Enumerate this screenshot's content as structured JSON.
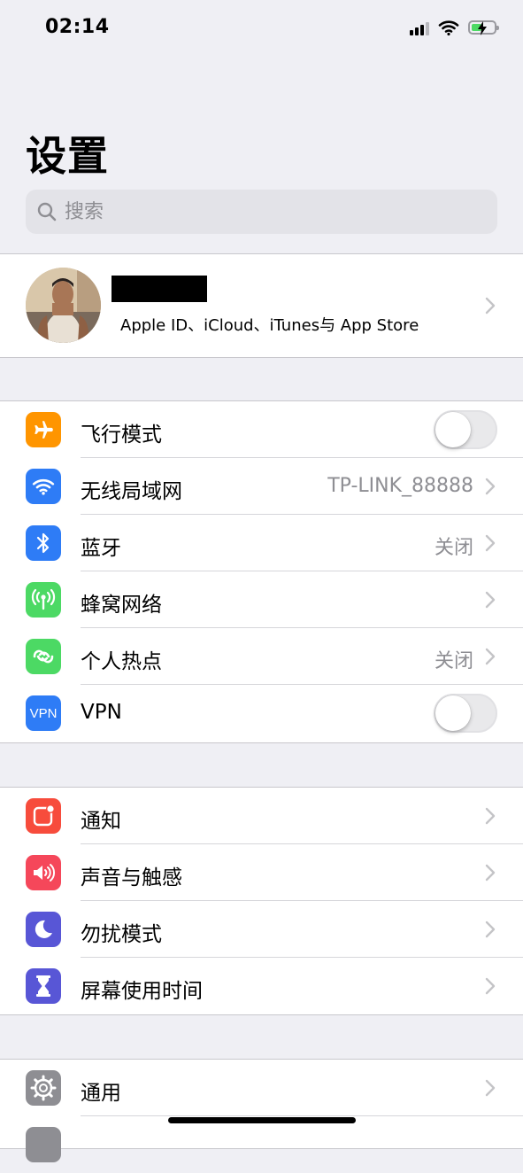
{
  "status_bar": {
    "time": "02:14"
  },
  "header": {
    "title": "设置"
  },
  "search": {
    "placeholder": "搜索"
  },
  "profile": {
    "subtitle": "Apple ID、iCloud、iTunes与 App Store"
  },
  "connectivity": [
    {
      "label": "飞行模式",
      "icon": "airplane-icon",
      "color": "#ff9500",
      "toggle": false
    },
    {
      "label": "无线局域网",
      "icon": "wifi-icon",
      "color": "#2e7cf6",
      "value": "TP-LINK_88888"
    },
    {
      "label": "蓝牙",
      "icon": "bluetooth-icon",
      "color": "#2e7cf6",
      "value": "关闭"
    },
    {
      "label": "蜂窝网络",
      "icon": "cellular-icon",
      "color": "#4cd964"
    },
    {
      "label": "个人热点",
      "icon": "hotspot-icon",
      "color": "#4cd964",
      "value": "关闭"
    },
    {
      "label": "VPN",
      "icon": "vpn-icon",
      "icon_text": "VPN",
      "color": "#2e7cf6",
      "toggle": false
    }
  ],
  "notifications_group": [
    {
      "label": "通知",
      "icon": "notifications-icon",
      "color": "#f74c3c"
    },
    {
      "label": "声音与触感",
      "icon": "sounds-icon",
      "color": "#f5475a"
    },
    {
      "label": "勿扰模式",
      "icon": "moon-icon",
      "color": "#5856d6"
    },
    {
      "label": "屏幕使用时间",
      "icon": "hourglass-icon",
      "color": "#5856d6"
    }
  ],
  "general_group": [
    {
      "label": "通用",
      "icon": "gear-icon",
      "color": "#8e8e93"
    }
  ]
}
